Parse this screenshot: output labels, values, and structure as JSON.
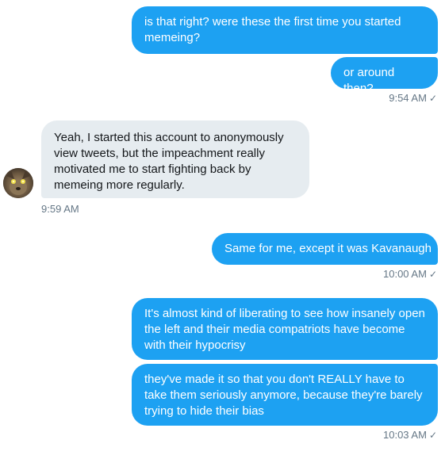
{
  "conversation": {
    "outgoing_1": "is that right? were these the first time you started memeing?",
    "outgoing_2": "or around then?",
    "time_1": "9:54 AM",
    "incoming_1": "Yeah, I started this account to anonymously view tweets, but the impeachment really motivated me to start fighting back by memeing more regularly.",
    "time_2": "9:59 AM",
    "outgoing_3": "Same for me, except it was Kavanaugh",
    "time_3": "10:00 AM",
    "outgoing_4": "It's almost kind of liberating to see how insanely open the left and their media compatriots have become with their hypocrisy",
    "outgoing_5": "they've made it so that you don't REALLY have to take them seriously anymore, because they're barely trying to hide their bias",
    "time_4": "10:03 AM",
    "read_check": "✓"
  },
  "colors": {
    "outgoing_bubble": "#1da1f2",
    "incoming_bubble": "#e6ecf0",
    "timestamp": "#657786"
  },
  "icons": {
    "read_receipt": "checkmark-icon",
    "avatar": "user-avatar-image"
  }
}
